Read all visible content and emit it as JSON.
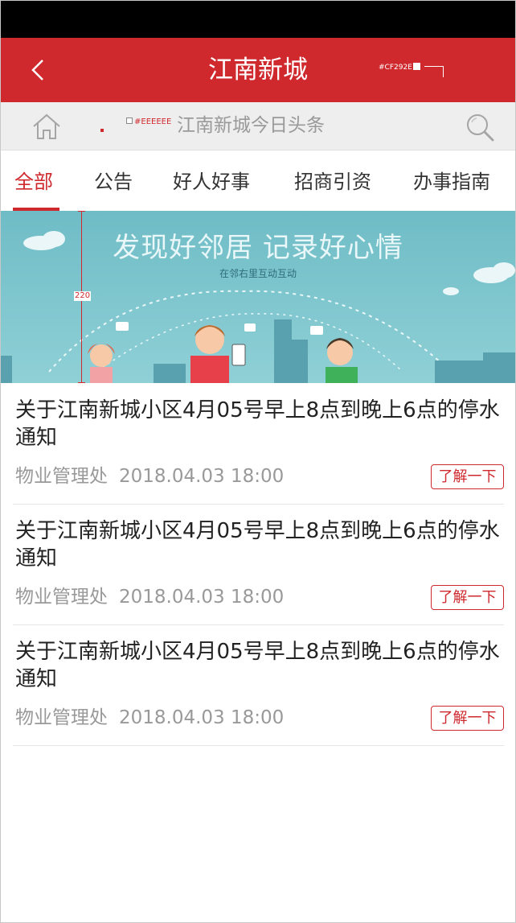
{
  "colors": {
    "brand": "#CF292E",
    "search_bg": "#EEEEEE"
  },
  "header": {
    "title": "江南新城",
    "back_icon": "chevron-left-icon",
    "color_annotation": "#CF292E"
  },
  "search_bar": {
    "home_icon": "home-icon",
    "headline_label": "江南新城今日头条",
    "color_annotation": "#EEEEEE",
    "search_icon": "search-icon"
  },
  "tabs": [
    {
      "label": "全部",
      "active": true
    },
    {
      "label": "公告",
      "active": false
    },
    {
      "label": "好人好事",
      "active": false
    },
    {
      "label": "招商引资",
      "active": false
    },
    {
      "label": "办事指南",
      "active": false
    }
  ],
  "banner": {
    "headline": "发现好邻居 记录好心情",
    "subtitle": "在邻右里互动互动",
    "height_annotation": "220"
  },
  "news": [
    {
      "title": "关于江南新城小区4月05号早上8点到晚上6点的停水通知",
      "source": "物业管理处",
      "date": "2018.04.03 18:00",
      "action": "了解一下"
    },
    {
      "title": "关于江南新城小区4月05号早上8点到晚上6点的停水通知",
      "source": "物业管理处",
      "date": "2018.04.03 18:00",
      "action": "了解一下"
    },
    {
      "title": "关于江南新城小区4月05号早上8点到晚上6点的停水通知",
      "source": "物业管理处",
      "date": "2018.04.03 18:00",
      "action": "了解一下"
    }
  ]
}
